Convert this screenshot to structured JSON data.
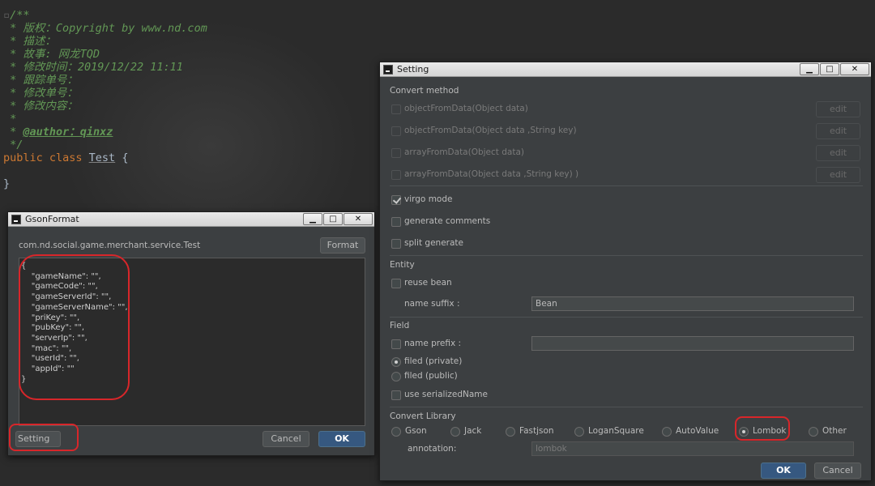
{
  "editor": {
    "lines": [
      "/**",
      " * 版权：Copyright by www.nd.com",
      " * 描述：",
      " * 故事: 网龙TQD",
      " * 修改时间：2019/12/22 11:11",
      " * 跟踪单号：",
      " * 修改单号：",
      " * 修改内容：",
      " *",
      " * ",
      " */"
    ],
    "author_tag": "@author：qinxz",
    "class_keywords": "public class ",
    "class_name": "Test",
    "brace_open": " {",
    "brace_close": "}"
  },
  "gson_window": {
    "title": "GsonFormat",
    "class_path": "com.nd.social.game.merchant.service.Test",
    "format_label": "Format",
    "json_lines": [
      "{",
      "    \"gameName\": \"\",",
      "    \"gameCode\": \"\",",
      "    \"gameServerId\": \"\",",
      "    \"gameServerName\": \"\",",
      "    \"priKey\": \"\",",
      "    \"pubKey\": \"\",",
      "    \"serverIp\": \"\",",
      "    \"mac\": \"\",",
      "    \"userId\": \"\",",
      "    \"appId\": \"\"",
      "}"
    ],
    "setting_label": "Setting",
    "cancel_label": "Cancel",
    "ok_label": "OK"
  },
  "setting_window": {
    "title": "Setting",
    "convert_method": {
      "heading": "Convert method",
      "items": [
        {
          "label": "objectFromData(Object data)",
          "edit": "edit"
        },
        {
          "label": "objectFromData(Object data ,String key)",
          "edit": "edit"
        },
        {
          "label": "arrayFromData(Object data)",
          "edit": "edit"
        },
        {
          "label": "arrayFromData(Object data ,String key) )",
          "edit": "edit"
        }
      ]
    },
    "virgo_mode": "virgo mode",
    "generate_comments": "generate comments",
    "split_generate": "split generate",
    "entity": {
      "heading": "Entity",
      "reuse_bean": "reuse bean",
      "name_suffix_label": "name suffix :",
      "name_suffix_value": "Bean"
    },
    "field": {
      "heading": "Field",
      "name_prefix_label": "name prefix :",
      "name_prefix_value": "",
      "filed_private": "filed (private)",
      "filed_public": "filed (public)",
      "use_serialized_name": "use serializedName"
    },
    "convert_library": {
      "heading": "Convert Library",
      "options": [
        "Gson",
        "Jack",
        "Fastjson",
        "LoganSquare",
        "AutoValue",
        "Lombok",
        "Other"
      ],
      "selected": "Lombok",
      "annotation_label": "annotation:",
      "annotation_value": "lombok"
    },
    "ok_label": "OK",
    "cancel_label": "Cancel"
  },
  "window_controls": {
    "minimize": "▁",
    "maximize": "□",
    "close": "✕"
  },
  "colors": {
    "accent_red": "#d8262a",
    "primary_button": "#365880",
    "comment_green": "#629755",
    "keyword_orange": "#cc7832"
  }
}
